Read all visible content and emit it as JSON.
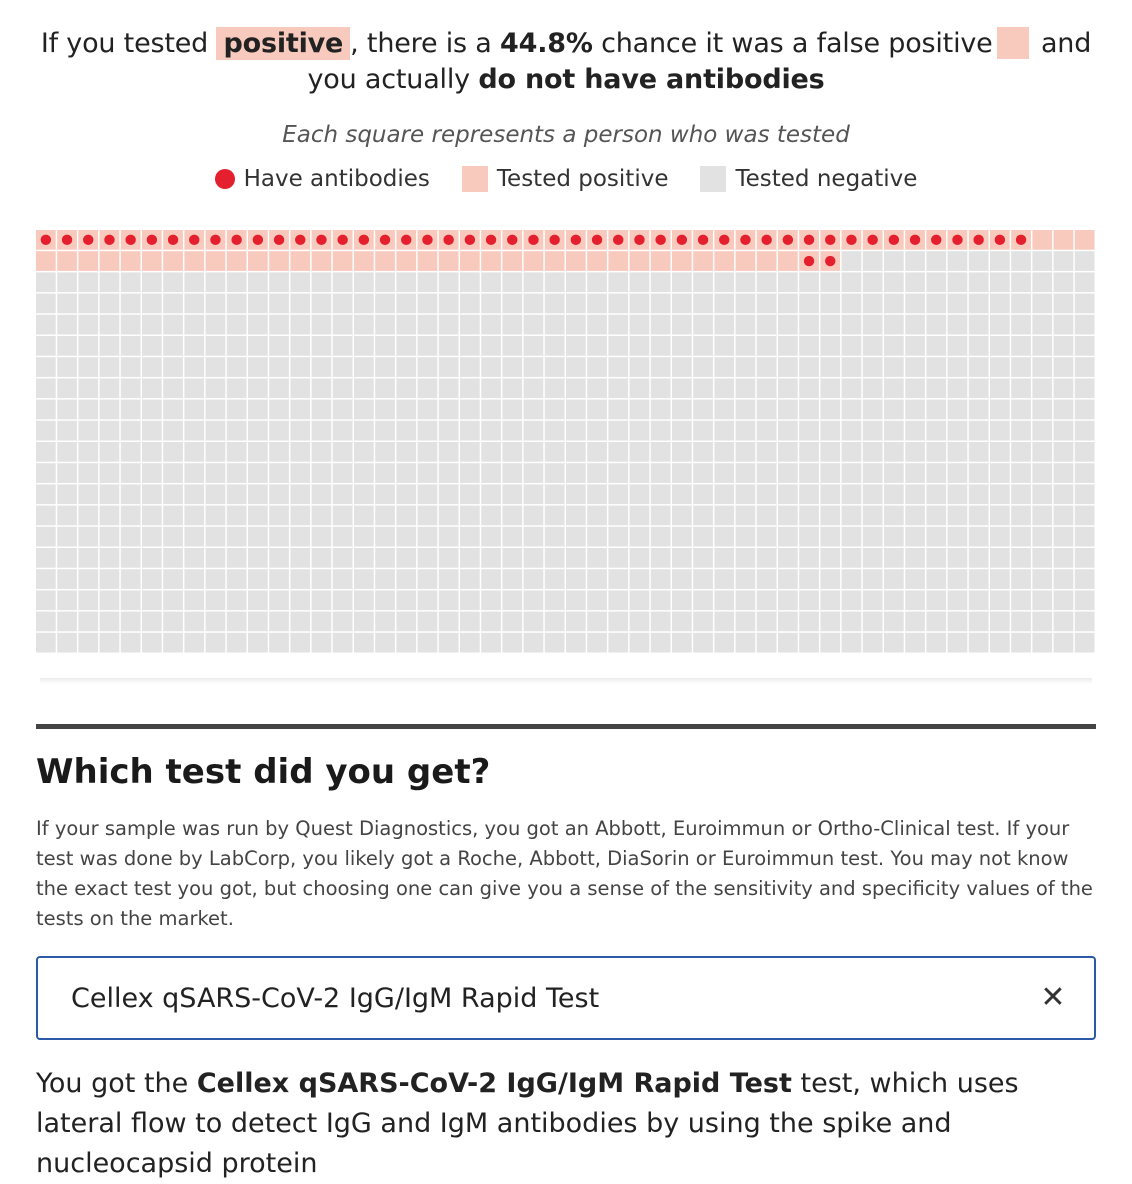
{
  "headline": {
    "prefix": "If you tested",
    "result_word": "positive",
    "middle": ", there is a",
    "percent": "44.8%",
    "after_percent": "chance it was a false positive",
    "suffix": "and you actually",
    "conclusion": "do not have antibodies"
  },
  "caption": "Each square represents a person who was tested",
  "legend": {
    "antibodies_label": "Have antibodies",
    "positive_label": "Tested positive",
    "negative_label": "Tested negative"
  },
  "colors": {
    "antibody_dot": "#e4202f",
    "positive_fill": "#f8c9bd",
    "negative_fill": "#e2e2e2",
    "select_border": "#2c5aa8"
  },
  "grid": {
    "columns": 50,
    "rows": 20,
    "total_people": 1000,
    "tested_positive": 88,
    "true_positives": 49
  },
  "section": {
    "title": "Which test did you get?",
    "body": "If your sample was run by Quest Diagnostics, you got an Abbott, Euroimmun or Ortho-Clinical test. If your test was done by LabCorp, you likely got a Roche, Abbott, DiaSorin or Euroimmun test. You may not know the exact test you got, but choosing one can give you a sense of the sensitivity and specificity values of the tests on the market."
  },
  "test_select": {
    "value": "Cellex qSARS-CoV-2 IgG/IgM Rapid Test",
    "clear_icon": "close-icon"
  },
  "result": {
    "prefix": "You got the",
    "test_name": "Cellex qSARS-CoV-2 IgG/IgM Rapid Test",
    "suffix": "test, which uses lateral flow to detect IgG and IgM antibodies by using the spike and nucleocapsid protein"
  }
}
